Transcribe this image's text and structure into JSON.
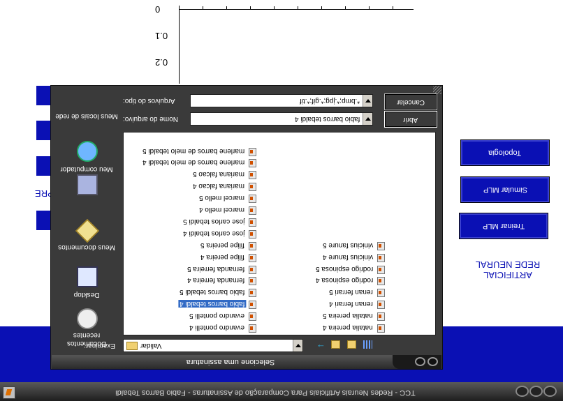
{
  "background_app": {
    "taskbar_title": "TCC - Redes Neurais Artificiais Para Comparação de Assinaturas - Fabio Barros Tebaldi",
    "chart": {
      "y_ticks": [
        "0",
        "0.1",
        "0.2"
      ]
    },
    "left_label": "PRE",
    "section_title_line1": "REDE NEURAL",
    "section_title_line2": "ARTIFICIAL",
    "buttons": {
      "topologia": "Topologia",
      "simular": "Simular MLP",
      "treinar": "Treinar MLP"
    }
  },
  "dialog": {
    "caption": "Selecione uma assinatura",
    "look_in_label": "Examinar:",
    "look_in_value": "Validar",
    "filename_label": "Nome do arquivo:",
    "filename_value": "fabio barros tebaldi 4",
    "filetype_label": "Arquivos do tipo:",
    "filetype_value": "*.bmp;*.jpg;*.gif;*.tif",
    "open_button": "Abrir",
    "cancel_button": "Cancelar",
    "places": [
      {
        "label": "Documentos recentes",
        "icon": "recent-documents-icon"
      },
      {
        "label": "Desktop",
        "icon": "desktop-icon"
      },
      {
        "label": "Meus documentos",
        "icon": "my-documents-icon"
      },
      {
        "label": "Meu computador",
        "icon": "my-computer-icon"
      },
      {
        "label": "Meus locais de rede",
        "icon": "network-places-icon"
      }
    ],
    "files_col1": [
      "evandro pontelli 4",
      "evandro pontelli 5",
      "fabio barros tebaldi 4",
      "fabio barros tebaldi 5",
      "fernanda ferreira 4",
      "fernanda ferreira 5",
      "filipe pereira 4",
      "filipe pereira 5",
      "jose carlos tebaldi 4",
      "jose carlos tebaldi 5",
      "marcel mello 4",
      "marcel mello 5",
      "mariana falcao 4",
      "mariana falcao 5",
      "marlene barros de melo tebaldi 4",
      "marlene barros de melo tebaldi 5"
    ],
    "files_col2": [
      "natalia pereira 4",
      "natalia pereira 5",
      "renan ferrari 4",
      "renan ferrari 5",
      "rodrigo espinosa 4",
      "rodrigo espinosa 5",
      "vinicius fanure 4",
      "vinicius fanure 5"
    ],
    "selected_file": "fabio barros tebaldi 4"
  }
}
